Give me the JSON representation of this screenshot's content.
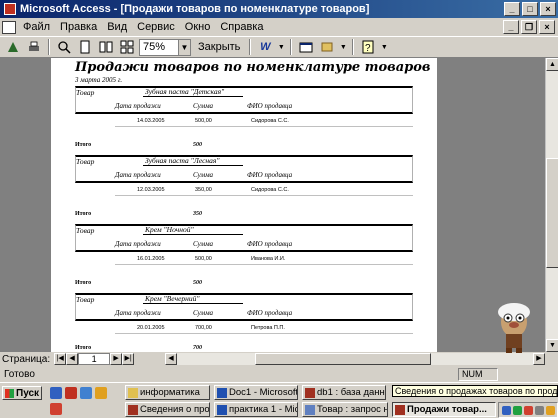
{
  "titlebar": {
    "title": "Microsoft Access - [Продажи товаров по номенклатуре товаров]",
    "min": "_",
    "max": "□",
    "close": "×"
  },
  "menu": {
    "items": [
      "Файл",
      "Правка",
      "Вид",
      "Сервис",
      "Окно",
      "Справка"
    ]
  },
  "toolbar": {
    "zoom": "75%",
    "close_label": "Закрыть"
  },
  "report": {
    "title": "Продажи товаров по номенклатуре товаров",
    "date": "3 марта 2005 г.",
    "col_product": "Товар",
    "col_date": "Дата продажи",
    "col_sum": "Сумма",
    "col_seller": "ФИО продавца",
    "total_label": "Итого",
    "groups": [
      {
        "name": "Зубная паста \"Детская\"",
        "date": "14.03.2005",
        "sum": "500,00",
        "seller": "Сидорова С.С.",
        "total": "500"
      },
      {
        "name": "Зубная паста \"Лесная\"",
        "date": "12.03.2005",
        "sum": "350,00",
        "seller": "Сидорова С.С.",
        "total": "350"
      },
      {
        "name": "Крем \"Ночной\"",
        "date": "16.01.2005",
        "sum": "500,00",
        "seller": "Иванова И.И.",
        "total": "500"
      },
      {
        "name": "Крем \"Вечерний\"",
        "date": "20.01.2005",
        "sum": "700,00",
        "seller": "Петрова П.П.",
        "total": "700"
      }
    ],
    "partial_total_label": "Итого"
  },
  "navbar": {
    "label": "Страница:",
    "page": "1"
  },
  "status": {
    "text": "Готово",
    "num": "NUM"
  },
  "taskbar": {
    "start": "Пуск",
    "tasks": [
      {
        "label": "информатика"
      },
      {
        "label": "Doc1 - Microsoft ..."
      },
      {
        "label": "db1 : база данных"
      },
      {
        "label": "Сведения о прод..."
      },
      {
        "label": "практика 1 - Micr..."
      },
      {
        "label": "Товар : запрос на..."
      },
      {
        "label": "Продажи товар..."
      }
    ],
    "tooltip": "Сведения о продажах товаров по продавцам"
  }
}
